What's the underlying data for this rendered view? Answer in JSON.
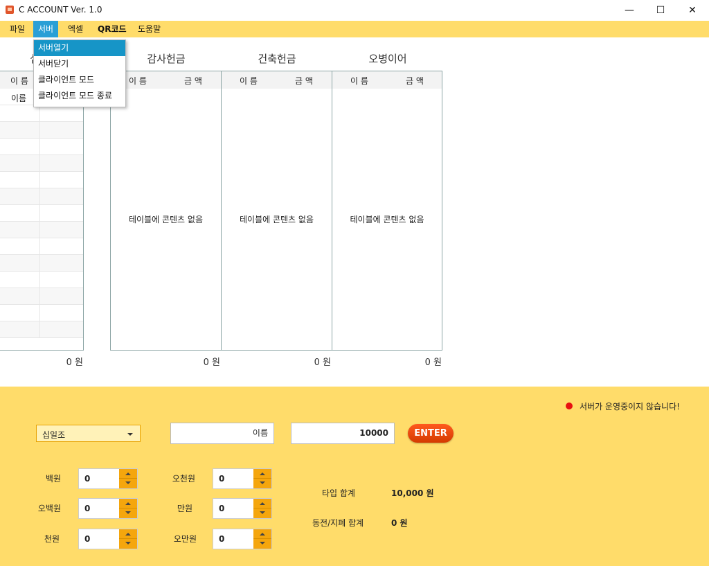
{
  "window": {
    "title": "C ACCOUNT Ver. 1.0",
    "minimize_glyph": "—",
    "maximize_glyph": "☐",
    "close_glyph": "✕"
  },
  "menubar": {
    "items": [
      {
        "label": "파일"
      },
      {
        "label": "서버"
      },
      {
        "label": "엑셀"
      },
      {
        "label": "QR코드"
      },
      {
        "label": "도움말"
      }
    ]
  },
  "dropdown": {
    "items": [
      {
        "label": "서버열기"
      },
      {
        "label": "서버닫기"
      },
      {
        "label": "클라이언트 모드"
      },
      {
        "label": "클라이언트 모드 종료"
      }
    ]
  },
  "tables": {
    "first": {
      "title_partial": "십",
      "header_name": "이 름",
      "row_name": "이름",
      "total": "0 원"
    },
    "columns": [
      {
        "title": "감사헌금",
        "header_name": "이 름",
        "header_amount": "금 액",
        "empty": "테이블에 콘텐츠 없음",
        "total": "0 원"
      },
      {
        "title": "건축헌금",
        "header_name": "이 름",
        "header_amount": "금 액",
        "empty": "테이블에 콘텐츠 없음",
        "total": "0 원"
      },
      {
        "title": "오병이어",
        "header_name": "이 름",
        "header_amount": "금 액",
        "empty": "테이블에 콘텐츠 없음",
        "total": "0 원"
      }
    ]
  },
  "status": {
    "color": "#e81010",
    "text": "서버가 운영중이지 않습니다!"
  },
  "entry": {
    "category": "십일조",
    "name_placeholder": "이름",
    "amount_value": "10000",
    "enter_label": "ENTER"
  },
  "denominations": {
    "left": [
      {
        "label": "백원",
        "value": "0"
      },
      {
        "label": "오백원",
        "value": "0"
      },
      {
        "label": "천원",
        "value": "0"
      }
    ],
    "right": [
      {
        "label": "오천원",
        "value": "0"
      },
      {
        "label": "만원",
        "value": "0"
      },
      {
        "label": "오만원",
        "value": "0"
      }
    ]
  },
  "sums": {
    "type_label": "타입 합계",
    "type_value": "10,000 원",
    "coin_label": "동전/지폐 합계",
    "coin_value": "0 원"
  }
}
